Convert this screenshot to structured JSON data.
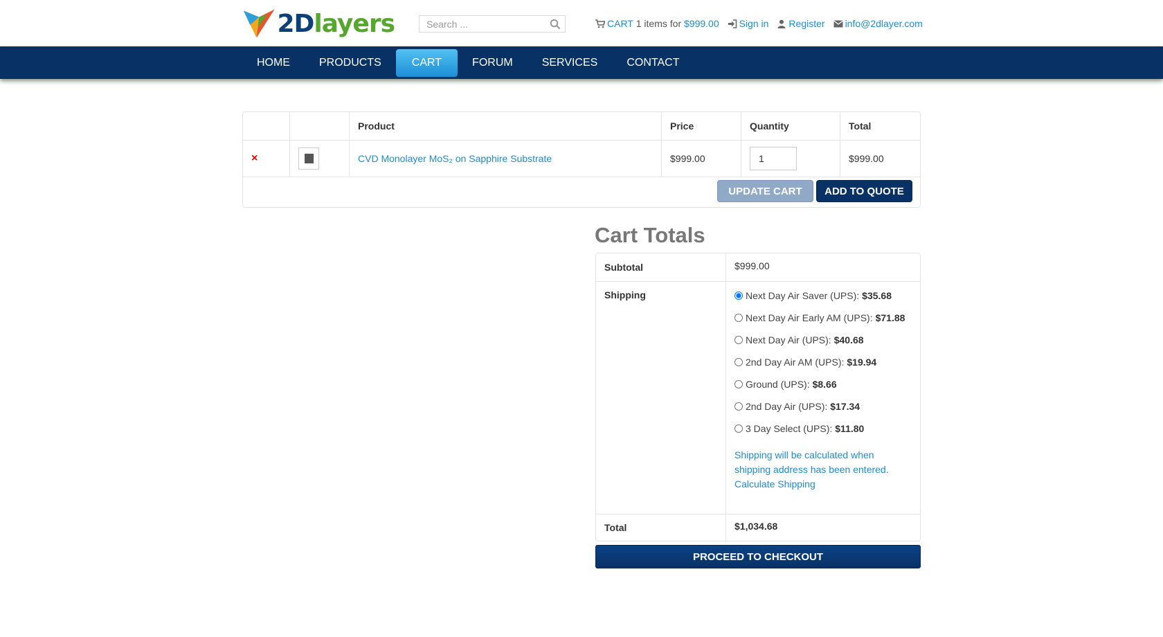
{
  "header": {
    "logo_text_a": "2D",
    "logo_text_b": "layers",
    "search_placeholder": "Search ...",
    "cart_label": "CART",
    "cart_items": "1 items for",
    "cart_amount": "$999.00",
    "sign_in": "Sign in",
    "register": "Register",
    "email": "info@2dlayer.com"
  },
  "nav": {
    "items": [
      {
        "label": "HOME"
      },
      {
        "label": "PRODUCTS"
      },
      {
        "label": "CART",
        "active": true
      },
      {
        "label": "FORUM"
      },
      {
        "label": "SERVICES"
      },
      {
        "label": "CONTACT"
      }
    ]
  },
  "cart": {
    "columns": [
      "",
      "",
      "Product",
      "Price",
      "Quantity",
      "Total"
    ],
    "rows": [
      {
        "remove": "×",
        "product": "CVD Monolayer MoS₂ on Sapphire Substrate",
        "price": "$999.00",
        "quantity": "1",
        "total": "$999.00"
      }
    ],
    "update_label": "UPDATE CART",
    "quote_label": "ADD TO QUOTE"
  },
  "totals": {
    "title": "Cart Totals",
    "subtotal_label": "Subtotal",
    "subtotal_value": "$999.00",
    "shipping_label": "Shipping",
    "shipping_options": [
      {
        "name": "Next Day Air Saver (UPS):",
        "price": "$35.68",
        "selected": true
      },
      {
        "name": "Next Day Air Early AM (UPS):",
        "price": "$71.88",
        "selected": false
      },
      {
        "name": "Next Day Air (UPS):",
        "price": "$40.68",
        "selected": false
      },
      {
        "name": "2nd Day Air AM (UPS):",
        "price": "$19.94",
        "selected": false
      },
      {
        "name": "Ground (UPS):",
        "price": "$8.66",
        "selected": false
      },
      {
        "name": "2nd Day Air (UPS):",
        "price": "$17.34",
        "selected": false
      },
      {
        "name": "3 Day Select (UPS):",
        "price": "$11.80",
        "selected": false
      }
    ],
    "shipping_note": "Shipping will be calculated when shipping address has been entered.",
    "calculate_label": "Calculate Shipping",
    "total_label": "Total",
    "total_value": "$1,034.68",
    "checkout_label": "PROCEED TO CHECKOUT"
  },
  "colors": {
    "navy": "#083265",
    "accent_blue": "#1e8bd6",
    "active_tab": "#35a9e6",
    "logo_green": "#56a72f",
    "remove_red": "#e00000"
  }
}
